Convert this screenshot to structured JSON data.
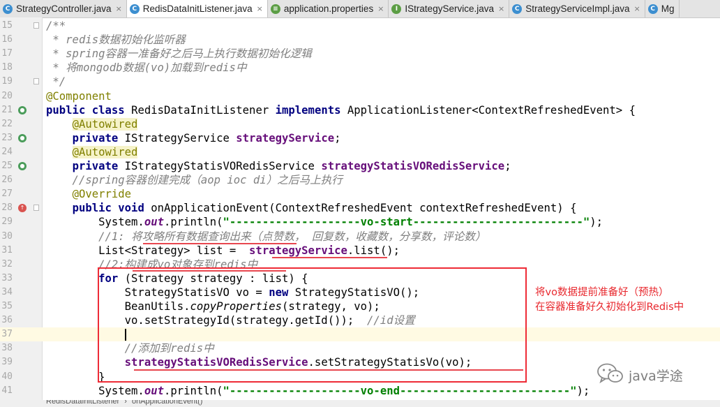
{
  "tabs": [
    {
      "label": "StrategyController.java",
      "icon": "class-c-icon",
      "iconColor": "#3d8fd0",
      "active": false,
      "closable": true
    },
    {
      "label": "RedisDataInitListener.java",
      "icon": "class-c-icon",
      "iconColor": "#3d8fd0",
      "active": true,
      "closable": true
    },
    {
      "label": "application.properties",
      "icon": "properties-file-icon",
      "iconColor": "#5c9e45",
      "active": false,
      "closable": true
    },
    {
      "label": "IStrategyService.java",
      "icon": "interface-i-icon",
      "iconColor": "#5c9e45",
      "active": false,
      "closable": true
    },
    {
      "label": "StrategyServiceImpl.java",
      "icon": "class-c-icon",
      "iconColor": "#3d8fd0",
      "active": false,
      "closable": true
    },
    {
      "label": "Mg",
      "icon": "class-c-icon",
      "iconColor": "#3d8fd0",
      "active": false,
      "closable": false
    }
  ],
  "code": {
    "lines": [
      {
        "n": "15",
        "marker": "",
        "fold": true,
        "segs": [
          {
            "t": "/**",
            "c": "cm"
          }
        ]
      },
      {
        "n": "16",
        "marker": "",
        "fold": false,
        "segs": [
          {
            "t": " * redis数据初始化监听器",
            "c": "cm"
          }
        ]
      },
      {
        "n": "17",
        "marker": "",
        "fold": false,
        "segs": [
          {
            "t": " * spring容器一准备好之后马上执行数据初始化逻辑",
            "c": "cm"
          }
        ]
      },
      {
        "n": "18",
        "marker": "",
        "fold": false,
        "segs": [
          {
            "t": " * 将mongodb数据(vo)加载到redis中",
            "c": "cm"
          }
        ]
      },
      {
        "n": "19",
        "marker": "",
        "fold": true,
        "segs": [
          {
            "t": " */",
            "c": "cm"
          }
        ]
      },
      {
        "n": "20",
        "marker": "",
        "fold": false,
        "segs": [
          {
            "t": "@Component",
            "c": "ann"
          }
        ]
      },
      {
        "n": "21",
        "marker": "spring-bean-icon",
        "fold": false,
        "segs": [
          {
            "t": "public class ",
            "c": "kw"
          },
          {
            "t": "RedisDataInitListener ",
            "c": ""
          },
          {
            "t": "implements ",
            "c": "kw"
          },
          {
            "t": "ApplicationListener<ContextRefreshedEvent> {",
            "c": ""
          }
        ]
      },
      {
        "n": "22",
        "marker": "",
        "fold": false,
        "segs": [
          {
            "t": "    ",
            "c": ""
          },
          {
            "t": "@Autowired",
            "c": "annhl"
          }
        ]
      },
      {
        "n": "23",
        "marker": "autowired-bean-icon",
        "fold": false,
        "segs": [
          {
            "t": "    ",
            "c": ""
          },
          {
            "t": "private ",
            "c": "kw"
          },
          {
            "t": "IStrategyService ",
            "c": ""
          },
          {
            "t": "strategyService",
            "c": "fld"
          },
          {
            "t": ";",
            "c": ""
          }
        ]
      },
      {
        "n": "24",
        "marker": "",
        "fold": false,
        "segs": [
          {
            "t": "    ",
            "c": ""
          },
          {
            "t": "@Autowired",
            "c": "annhl"
          }
        ]
      },
      {
        "n": "25",
        "marker": "autowired-bean-icon",
        "fold": false,
        "segs": [
          {
            "t": "    ",
            "c": ""
          },
          {
            "t": "private ",
            "c": "kw"
          },
          {
            "t": "IStrategyStatisVORedisService ",
            "c": ""
          },
          {
            "t": "strategyStatisVORedisService",
            "c": "fld"
          },
          {
            "t": ";",
            "c": ""
          }
        ]
      },
      {
        "n": "26",
        "marker": "",
        "fold": false,
        "segs": [
          {
            "t": "    //spring容器创建完成（aop ioc di）之后马上执行",
            "c": "cm"
          }
        ]
      },
      {
        "n": "27",
        "marker": "",
        "fold": false,
        "segs": [
          {
            "t": "    ",
            "c": ""
          },
          {
            "t": "@Override",
            "c": "ann"
          }
        ]
      },
      {
        "n": "28",
        "marker": "override-method-icon",
        "fold": true,
        "segs": [
          {
            "t": "    ",
            "c": ""
          },
          {
            "t": "public void ",
            "c": "kw"
          },
          {
            "t": "onApplicationEvent(ContextRefreshedEvent contextRefreshedEvent) {",
            "c": ""
          }
        ]
      },
      {
        "n": "29",
        "marker": "",
        "fold": false,
        "segs": [
          {
            "t": "        System.",
            "c": ""
          },
          {
            "t": "out",
            "c": "stf"
          },
          {
            "t": ".println(",
            "c": ""
          },
          {
            "t": "\"--------------------vo-start--------------------------\"",
            "c": "str"
          },
          {
            "t": ");",
            "c": ""
          }
        ]
      },
      {
        "n": "30",
        "marker": "",
        "fold": false,
        "segs": [
          {
            "t": "        //1: 将攻略所有数据查询出来（点赞数， 回复数，收藏数，分享数，评论数）",
            "c": "cm"
          }
        ]
      },
      {
        "n": "31",
        "marker": "",
        "fold": false,
        "segs": [
          {
            "t": "        List<Strategy> list = ",
            "c": ""
          },
          {
            "t": " strategyService",
            "c": "fld"
          },
          {
            "t": ".list();",
            "c": ""
          }
        ]
      },
      {
        "n": "32",
        "marker": "",
        "fold": false,
        "segs": [
          {
            "t": "        //2:构建成vo对象存到redis中",
            "c": "cm"
          }
        ]
      },
      {
        "n": "33",
        "marker": "",
        "fold": false,
        "segs": [
          {
            "t": "        ",
            "c": ""
          },
          {
            "t": "for ",
            "c": "kw"
          },
          {
            "t": "(Strategy strategy : list) {",
            "c": ""
          }
        ]
      },
      {
        "n": "34",
        "marker": "",
        "fold": false,
        "segs": [
          {
            "t": "            StrategyStatisVO vo = ",
            "c": ""
          },
          {
            "t": "new ",
            "c": "kw"
          },
          {
            "t": "StrategyStatisVO();",
            "c": ""
          }
        ]
      },
      {
        "n": "35",
        "marker": "",
        "fold": false,
        "segs": [
          {
            "t": "            BeanUtils.",
            "c": ""
          },
          {
            "t": "copyProperties",
            "c": "st"
          },
          {
            "t": "(strategy, vo);",
            "c": ""
          }
        ]
      },
      {
        "n": "36",
        "marker": "",
        "fold": false,
        "segs": [
          {
            "t": "            vo.setStrategyId(strategy.getId());  ",
            "c": ""
          },
          {
            "t": "//id设置",
            "c": "cm"
          }
        ]
      },
      {
        "n": "37",
        "marker": "",
        "fold": false,
        "current": true,
        "caret": true,
        "segs": [
          {
            "t": "            ",
            "c": ""
          }
        ]
      },
      {
        "n": "38",
        "marker": "",
        "fold": false,
        "segs": [
          {
            "t": "            //添加到redis中",
            "c": "cm"
          }
        ]
      },
      {
        "n": "39",
        "marker": "",
        "fold": false,
        "segs": [
          {
            "t": "            ",
            "c": ""
          },
          {
            "t": "strategyStatisVORedisService",
            "c": "fld"
          },
          {
            "t": ".setStrategyStatisVo(vo);",
            "c": ""
          }
        ]
      },
      {
        "n": "40",
        "marker": "",
        "fold": false,
        "segs": [
          {
            "t": "        }",
            "c": ""
          }
        ]
      },
      {
        "n": "41",
        "marker": "",
        "fold": false,
        "segs": [
          {
            "t": "        System.",
            "c": ""
          },
          {
            "t": "out",
            "c": "stf"
          },
          {
            "t": ".println(",
            "c": ""
          },
          {
            "t": "\"--------------------vo-end--------------------------\"",
            "c": "str"
          },
          {
            "t": ");",
            "c": ""
          }
        ]
      }
    ]
  },
  "annotation": {
    "line1": "将vo数据提前准备好（预热）",
    "line2": "在容器准备好久初始化到Redis中",
    "color": "#e8282e"
  },
  "breadcrumb": {
    "class_name": "RedisDataInitListener",
    "separator": "›",
    "method_name": "onApplicationEvent()"
  },
  "watermark": {
    "icon": "wechat-icon",
    "text": "java学途"
  }
}
